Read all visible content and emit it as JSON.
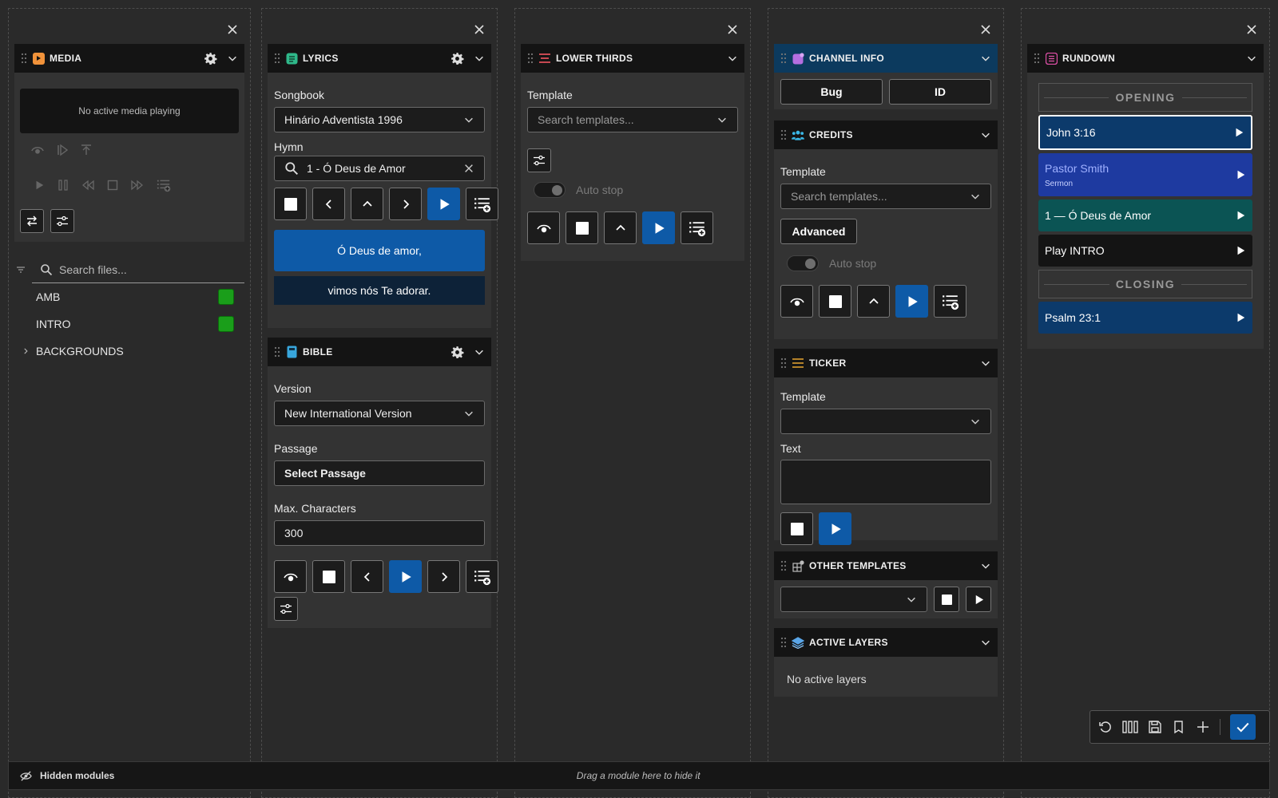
{
  "media": {
    "title": "MEDIA",
    "no_media": "No active media playing",
    "search_placeholder": "Search files...",
    "files": [
      {
        "name": "AMB",
        "color": "#1a9e1a"
      },
      {
        "name": "INTRO",
        "color": "#1a9e1a"
      }
    ],
    "folder": "BACKGROUNDS"
  },
  "lyrics": {
    "title": "LYRICS",
    "songbook_label": "Songbook",
    "songbook_value": "Hinário Adventista 1996",
    "hymn_label": "Hymn",
    "hymn_value": "1 - Ó Deus de Amor",
    "verse_current": "Ó Deus de amor,",
    "verse_next": "vimos nós Te adorar."
  },
  "bible": {
    "title": "BIBLE",
    "version_label": "Version",
    "version_value": "New International Version",
    "passage_label": "Passage",
    "passage_button": "Select Passage",
    "maxchars_label": "Max. Characters",
    "maxchars_value": "300"
  },
  "lower_thirds": {
    "title": "LOWER THIRDS",
    "template_label": "Template",
    "template_placeholder": "Search templates...",
    "autostop_label": "Auto stop"
  },
  "channel_info": {
    "title": "CHANNEL INFO",
    "bug_label": "Bug",
    "id_label": "ID"
  },
  "credits": {
    "title": "CREDITS",
    "template_label": "Template",
    "template_placeholder": "Search templates...",
    "advanced_label": "Advanced",
    "autostop_label": "Auto stop"
  },
  "ticker": {
    "title": "TICKER",
    "template_label": "Template",
    "text_label": "Text"
  },
  "other_templates": {
    "title": "OTHER TEMPLATES"
  },
  "active_layers": {
    "title": "ACTIVE LAYERS",
    "empty": "No active layers"
  },
  "rundown": {
    "title": "RUNDOWN",
    "sections": [
      "OPENING",
      "CLOSING"
    ],
    "items": [
      {
        "title": "John 3:16",
        "subtitle": "",
        "color": "#0c3a6b"
      },
      {
        "title": "Pastor Smith",
        "subtitle": "Sermon",
        "color": "#1e3aa0"
      },
      {
        "title": "1 — Ó Deus de Amor",
        "subtitle": "",
        "color": "#0b5454"
      },
      {
        "title": "Play INTRO",
        "subtitle": "",
        "color": "#141414"
      },
      {
        "title": "Psalm 23:1",
        "subtitle": "",
        "color": "#0c3a6b"
      }
    ]
  },
  "footer": {
    "hidden_label": "Hidden modules",
    "drag_hint": "Drag a module here to hide it"
  },
  "colors": {
    "accent": "#0e5aa7",
    "header_blue": "#0c3a5e",
    "panel": "#333333"
  }
}
